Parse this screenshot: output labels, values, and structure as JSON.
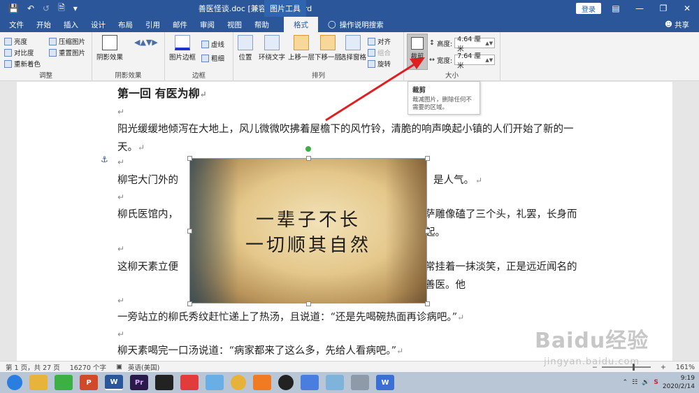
{
  "titlebar": {
    "doc_title": "善医怪谈.doc [兼容模式] - Word",
    "context_tab_title": "图片工具",
    "login_label": "登录"
  },
  "tabs": [
    "文件",
    "开始",
    "插入",
    "设计",
    "布局",
    "引用",
    "邮件",
    "审阅",
    "视图",
    "帮助",
    "格式"
  ],
  "active_tab": "格式",
  "tellme": "操作说明搜索",
  "share_label": "共享",
  "ribbon": {
    "adjust": {
      "label": "调整",
      "items": [
        "亮度",
        "对比度",
        "重新着色",
        "压缩图片",
        "重置图片"
      ]
    },
    "shadow": {
      "label": "阴影效果",
      "big_button": "阴影效果"
    },
    "border": {
      "label": "边框",
      "big_button": "图片边框",
      "dashes": "虚线",
      "weight": "粗细"
    },
    "arrange": {
      "label": "排列",
      "buttons": [
        "位置",
        "环绕文字",
        "上移一层",
        "下移一层",
        "选择窗格"
      ],
      "align": "对齐",
      "group": "组合",
      "rotate": "旋转"
    },
    "size": {
      "label": "大小",
      "crop": "裁剪",
      "height_label": "高度:",
      "height_value": "4.64 厘米",
      "width_label": "宽度:",
      "width_value": "7.64 厘米"
    }
  },
  "tooltip": {
    "title": "裁剪",
    "body": "裁减图片，删除任何不需要的区域。"
  },
  "document": {
    "heading": "第一回  有医为柳",
    "paragraphs": [
      "阳光缓缓地倾泻在大地上，风儿微微吹拂着屋檐下的风竹铃，清脆的响声唤起小镇的人们开始了新的一天。",
      "柳宅大门外的",
      "是人气。",
      "柳氏医馆内，",
      "萨雕像磕了三个头，礼罢，长身而起。",
      "这柳天素立便",
      "常挂着一抹淡笑，正是远近闻名的善医。他",
      "一旁站立的柳氏秀纹赶忙递上了热汤，且说道：“还是先喝碗热面再诊病吧。”",
      "柳天素喝完一口汤说道：“病家都来了这么多，先给人看病吧。”"
    ],
    "picture_lines": [
      "一辈子不长",
      "一切顺其自然"
    ]
  },
  "statusbar": {
    "page": "第 1 页，共 27 页",
    "words": "16270 个字",
    "language": "英语(美国)",
    "zoom": "161%"
  },
  "taskbar": {
    "time": "9:19",
    "date": "2020/2/14"
  },
  "watermark": {
    "big": "Baidu经验",
    "small": "jingyan.baidu.com"
  }
}
